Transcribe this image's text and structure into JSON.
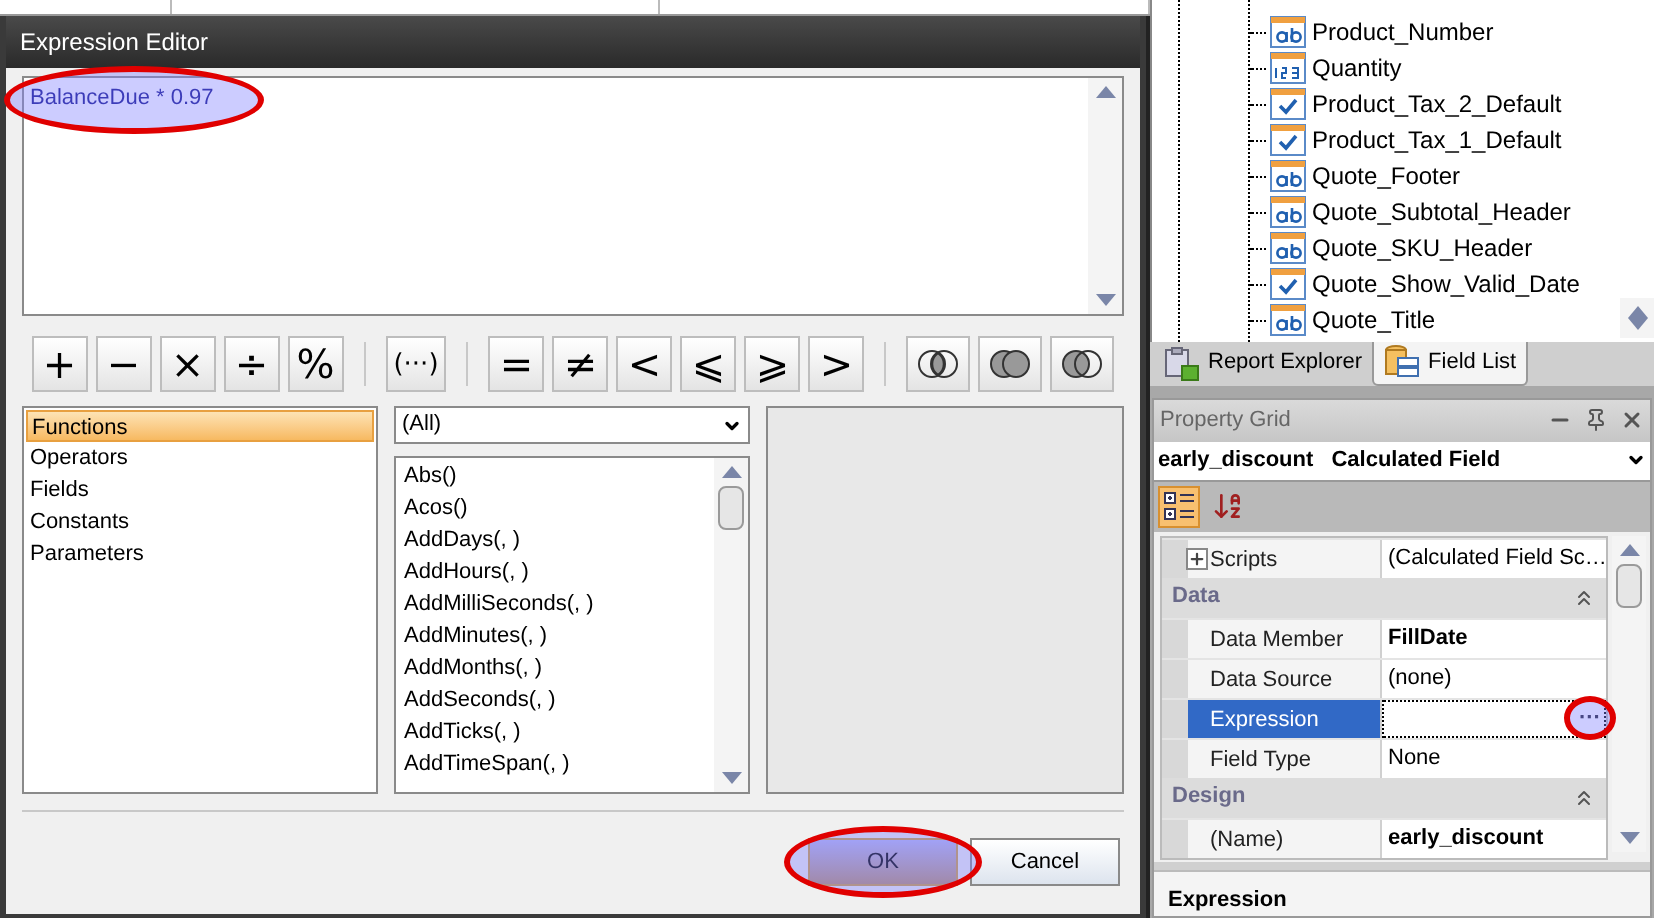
{
  "dialog": {
    "title": "Expression Editor",
    "expression": "BalanceDue * 0.97",
    "expression_circled": true,
    "operator_groups": [
      [
        {
          "kind": "symbol",
          "symbol": "+"
        },
        {
          "kind": "symbol",
          "symbol": "−"
        },
        {
          "kind": "symbol",
          "symbol": "×"
        },
        {
          "kind": "symbol",
          "symbol": "÷"
        },
        {
          "kind": "symbol",
          "symbol": "%"
        }
      ],
      [
        {
          "kind": "symbol",
          "symbol": "(···)"
        }
      ],
      [
        {
          "kind": "symbol",
          "symbol": "="
        },
        {
          "kind": "symbol",
          "symbol": "≠"
        },
        {
          "kind": "symbol",
          "symbol": "<"
        },
        {
          "kind": "symbol",
          "symbol": "⩽"
        },
        {
          "kind": "symbol",
          "symbol": "⩾"
        },
        {
          "kind": "symbol",
          "symbol": ">"
        }
      ],
      [
        {
          "kind": "and"
        },
        {
          "kind": "or"
        },
        {
          "kind": "not"
        }
      ]
    ],
    "categories": [
      {
        "label": "Functions",
        "selected": true
      },
      {
        "label": "Operators",
        "selected": false
      },
      {
        "label": "Fields",
        "selected": false
      },
      {
        "label": "Constants",
        "selected": false
      },
      {
        "label": "Parameters",
        "selected": false
      }
    ],
    "filter": "(All)",
    "functions": [
      "Abs()",
      "Acos()",
      "AddDays(, )",
      "AddHours(, )",
      "AddMilliSeconds(, )",
      "AddMinutes(, )",
      "AddMonths(, )",
      "AddSeconds(, )",
      "AddTicks(, )",
      "AddTimeSpan(, )"
    ],
    "ok": {
      "label": "OK",
      "circled": true
    },
    "cancel": {
      "label": "Cancel"
    }
  },
  "field_list": {
    "items": [
      {
        "label": "Product_Number",
        "kind": "text"
      },
      {
        "label": "Quantity",
        "kind": "number"
      },
      {
        "label": "Product_Tax_2_Default",
        "kind": "boolean"
      },
      {
        "label": "Product_Tax_1_Default",
        "kind": "boolean"
      },
      {
        "label": "Quote_Footer",
        "kind": "text"
      },
      {
        "label": "Quote_Subtotal_Header",
        "kind": "text"
      },
      {
        "label": "Quote_SKU_Header",
        "kind": "text"
      },
      {
        "label": "Quote_Show_Valid_Date",
        "kind": "boolean"
      },
      {
        "label": "Quote_Title",
        "kind": "text"
      }
    ],
    "tabs": [
      {
        "label": "Report Explorer",
        "kind": "explorer",
        "selected": false
      },
      {
        "label": "Field List",
        "kind": "fields",
        "selected": true
      }
    ]
  },
  "property_grid": {
    "title": "Property Grid",
    "object_name": "early_discount",
    "object_type": "Calculated Field",
    "toolbar": [
      {
        "kind": "categorized",
        "selected": true
      },
      {
        "kind": "alphabetical",
        "selected": false
      }
    ],
    "rows": [
      {
        "kind": "property",
        "name": "Scripts",
        "value": "(Calculated Field Sc…",
        "expandable": true,
        "bold": false,
        "selected": false
      },
      {
        "kind": "category",
        "name": "Data"
      },
      {
        "kind": "property",
        "name": "Data Member",
        "value": "FillDate",
        "bold": true,
        "selected": false
      },
      {
        "kind": "property",
        "name": "Data Source",
        "value": "(none)",
        "bold": false,
        "selected": false
      },
      {
        "kind": "property",
        "name": "Expression",
        "button": "···",
        "button_circled": true,
        "selected": true
      },
      {
        "kind": "property",
        "name": "Field Type",
        "value": "None",
        "bold": false,
        "selected": false
      },
      {
        "kind": "category",
        "name": "Design"
      },
      {
        "kind": "property",
        "name": "(Name)",
        "value": "early_discount",
        "bold": true,
        "selected": false
      }
    ],
    "description_title": "Expression"
  }
}
